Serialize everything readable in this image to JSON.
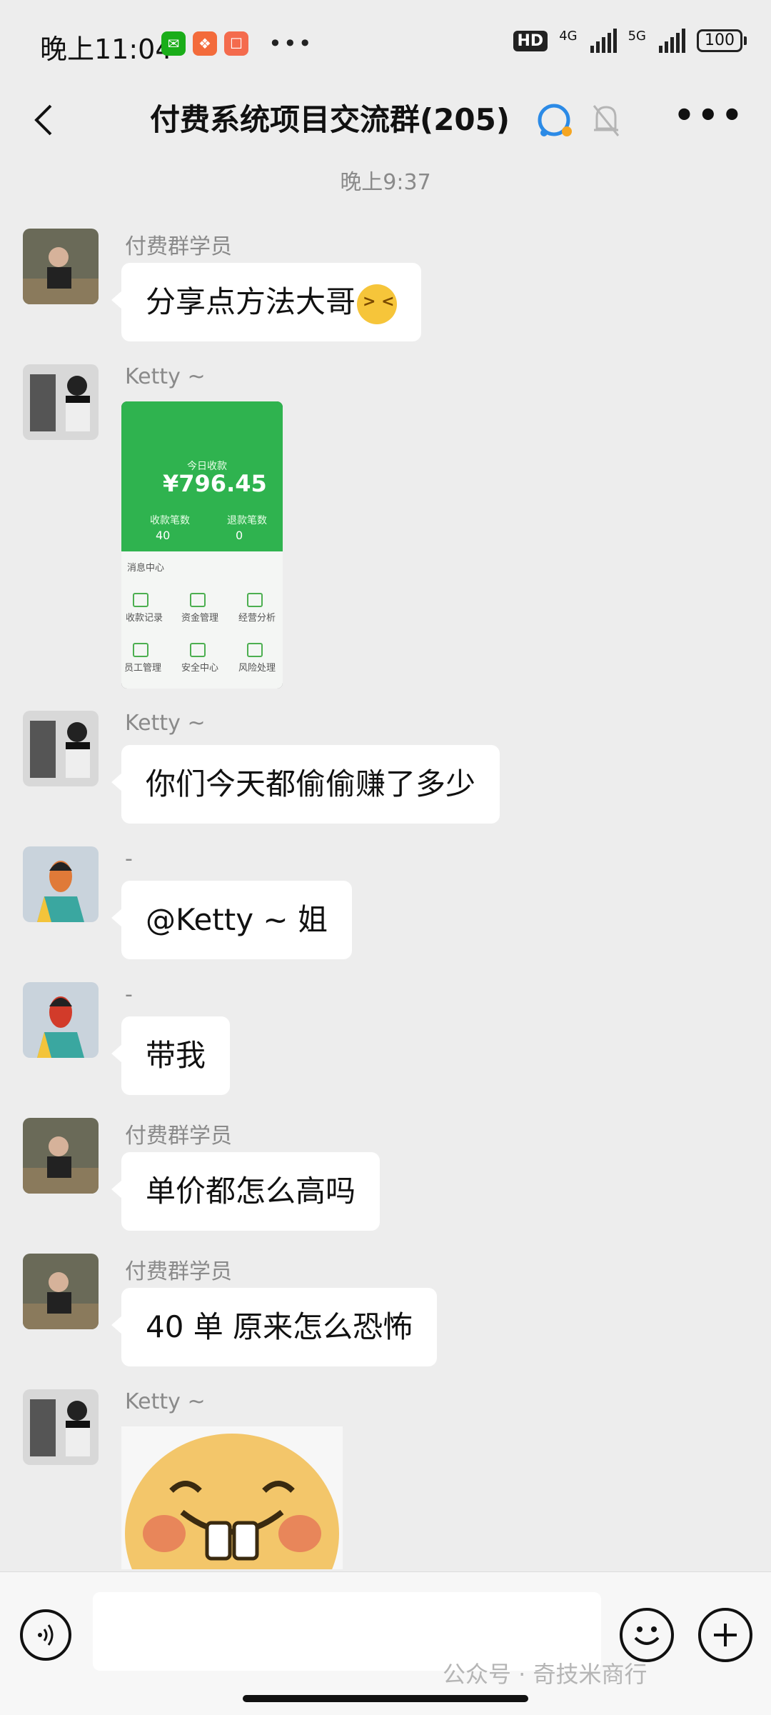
{
  "status_bar": {
    "time": "晚上11:04",
    "hd_badge": "HD",
    "net1": "4G",
    "net2": "5G",
    "battery": "100"
  },
  "header": {
    "title": "付费系统项目交流群(205)"
  },
  "chat": {
    "timestamp": "晚上9:37",
    "messages": [
      {
        "sender": "付费群学员",
        "text": "分享点方法大哥"
      },
      {
        "sender": "Ketty ~",
        "image": {
          "amount": "¥796.45",
          "count": "40",
          "count2": "0",
          "menu": [
            "消息中心",
            "收款记录",
            "资金管理",
            "经营分析",
            "员工管理",
            "安全中心",
            "风险处理"
          ]
        }
      },
      {
        "sender": "Ketty ~",
        "text": "你们今天都偷偷赚了多少"
      },
      {
        "sender": "-",
        "text": "@Ketty ~   姐"
      },
      {
        "sender": "-",
        "text": "带我"
      },
      {
        "sender": "付费群学员",
        "text": "单价都怎么高吗"
      },
      {
        "sender": "付费群学员",
        "text": "40 单 原来怎么恐怖"
      },
      {
        "sender": "Ketty ~",
        "sticker": "buck-tooth-smiley"
      }
    ]
  },
  "watermark": "公众号 · 奇技米商行",
  "colors": {
    "background": "#ededed",
    "bubble": "#ffffff",
    "wechat_green": "#2fb34f"
  }
}
